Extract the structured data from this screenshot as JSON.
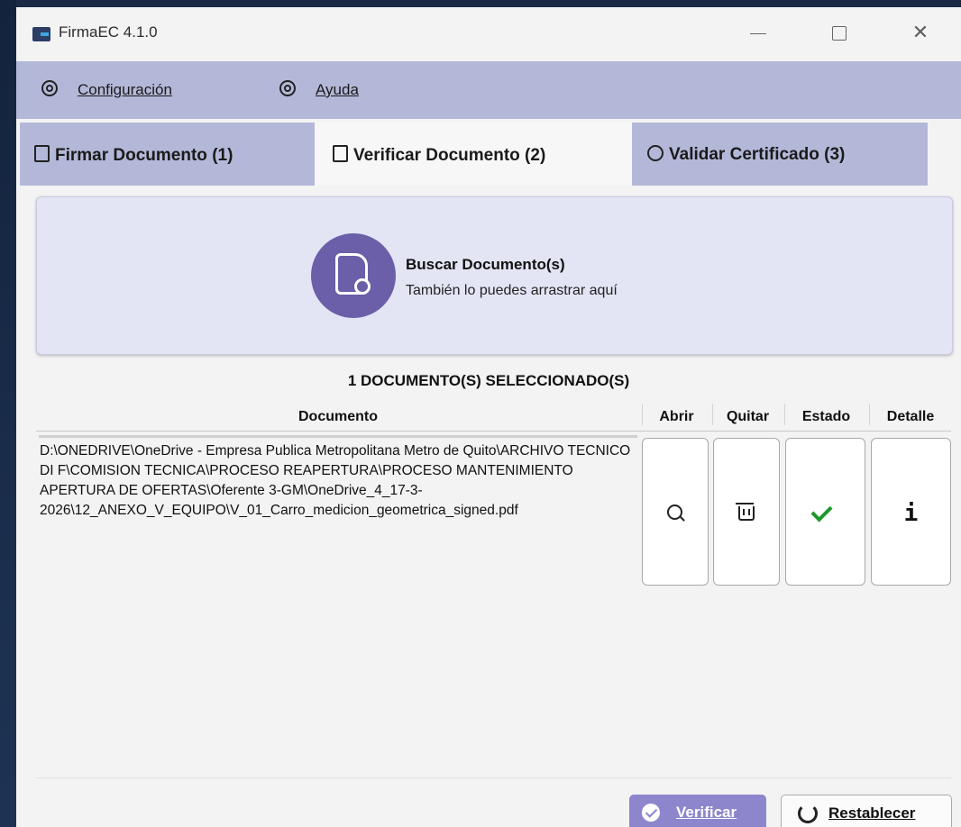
{
  "window": {
    "title": "FirmaEC 4.1.0"
  },
  "menu": {
    "config_label": "Configuración",
    "help_label": "Ayuda"
  },
  "tabs": [
    {
      "label": "Firmar Documento (1)",
      "active": false
    },
    {
      "label": "Verificar Documento (2)",
      "active": true
    },
    {
      "label": "Validar Certificado (3)",
      "active": false
    }
  ],
  "drop_zone": {
    "title": "Buscar Documento(s)",
    "subtitle": "También lo puedes arrastrar aquí"
  },
  "selected_count": "1 DOCUMENTO(S) SELECCIONADO(S)",
  "table": {
    "headers": [
      "Documento",
      "Abrir",
      "Quitar",
      "Estado",
      "Detalle"
    ],
    "rows": [
      {
        "path": "D:\\ONEDRIVE\\OneDrive - Empresa Publica Metropolitana Metro de Quito\\ARCHIVO TECNICO DI F\\COMISION TECNICA\\PROCESO REAPERTURA\\PROCESO MANTENIMIENTO APERTURA DE OFERTAS\\Oferente 3-GM\\OneDrive_4_17-3-2026\\12_ANEXO_V_EQUIPO\\V_01_Carro_medicion_geometrica_signed.pdf",
        "estado_icon": "check-icon",
        "estado_color": "#1a9a2a"
      }
    ]
  },
  "buttons": {
    "verificar_label": "Verificar",
    "restablecer_label": "Restablecer"
  },
  "colors": {
    "menu_bg": "#b4b8d8",
    "accent": "#6a5fa8",
    "verificar_bg": "#8d86cc"
  }
}
